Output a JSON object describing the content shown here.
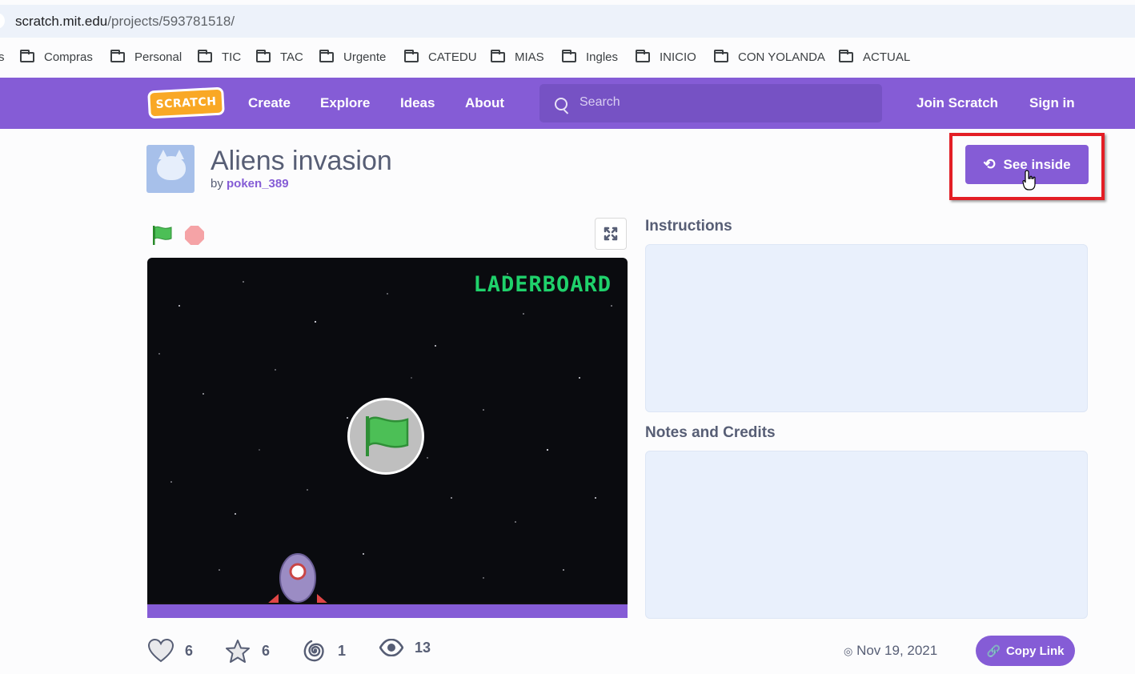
{
  "browser": {
    "url_host": "scratch.mit.edu",
    "url_path": "/projects/593781518/",
    "bookmarks": [
      "Compras",
      "Personal",
      "TIC",
      "TAC",
      "Urgente",
      "CATEDU",
      "MIAS",
      "Ingles",
      "INICIO",
      "CON YOLANDA",
      "ACTUAL"
    ],
    "bookmark_fragment": "s"
  },
  "nav": {
    "logo": "SCRATCH",
    "links": [
      "Create",
      "Explore",
      "Ideas",
      "About"
    ],
    "search_placeholder": "Search",
    "join": "Join Scratch",
    "signin": "Sign in"
  },
  "project": {
    "title": "Aliens invasion",
    "by_label": "by",
    "author": "poken_389",
    "see_inside": "See inside",
    "stage_text": "LADERBOARD",
    "instructions_label": "Instructions",
    "notes_label": "Notes and Credits",
    "stats": {
      "loves": "6",
      "favorites": "6",
      "remixes": "1",
      "views": "13"
    },
    "date": "Nov 19, 2021",
    "copy_link": "Copy Link"
  },
  "colors": {
    "brand": "#855cd6",
    "highlight": "#e31e25",
    "stage_text": "#1fd16b"
  }
}
